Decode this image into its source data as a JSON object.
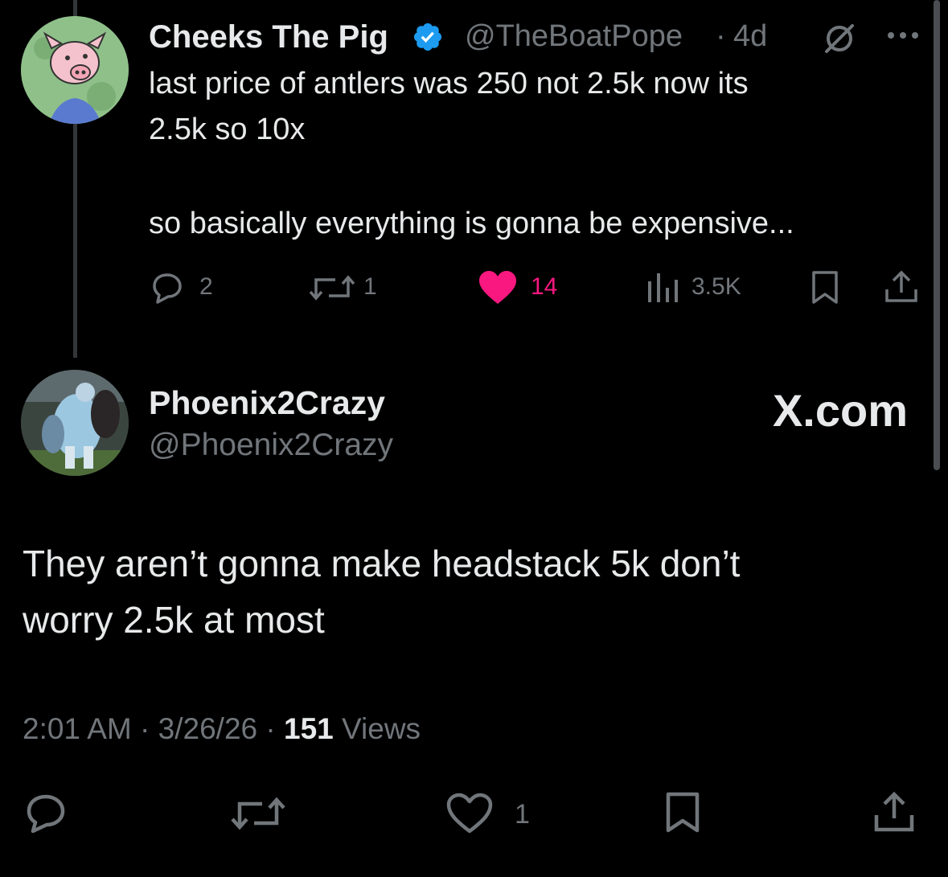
{
  "tweet1": {
    "name": "Cheeks The Pig",
    "handle": "@TheBoatPope",
    "sep": "·",
    "time": "4d",
    "line1": "last price of antlers was 250 not 2.5k now its",
    "line2": "2.5k so 10x",
    "line3": "so basically everything is gonna be expensive...",
    "replies": "2",
    "reposts": "1",
    "likes": "14",
    "views": "3.5K"
  },
  "tweet2": {
    "name": "Phoenix2Crazy",
    "handle": "@Phoenix2Crazy",
    "source": "X.com",
    "line1": "They aren’t gonna make headstack 5k don’t",
    "line2": "worry 2.5k at most",
    "time": "2:01 AM",
    "date": "3/26/26",
    "sep": "·",
    "views_count": "151",
    "views_label": "Views",
    "likes": "1"
  },
  "colors": {
    "background": "#000000",
    "text": "#e7e9ea",
    "muted": "#71767b",
    "verified": "#1d9bf0",
    "like": "#f91880"
  },
  "icons": [
    "verified-badge-icon",
    "muted-slash-icon",
    "more-icon",
    "reply-icon",
    "repost-icon",
    "heart-icon",
    "views-icon",
    "bookmark-icon",
    "share-icon"
  ]
}
